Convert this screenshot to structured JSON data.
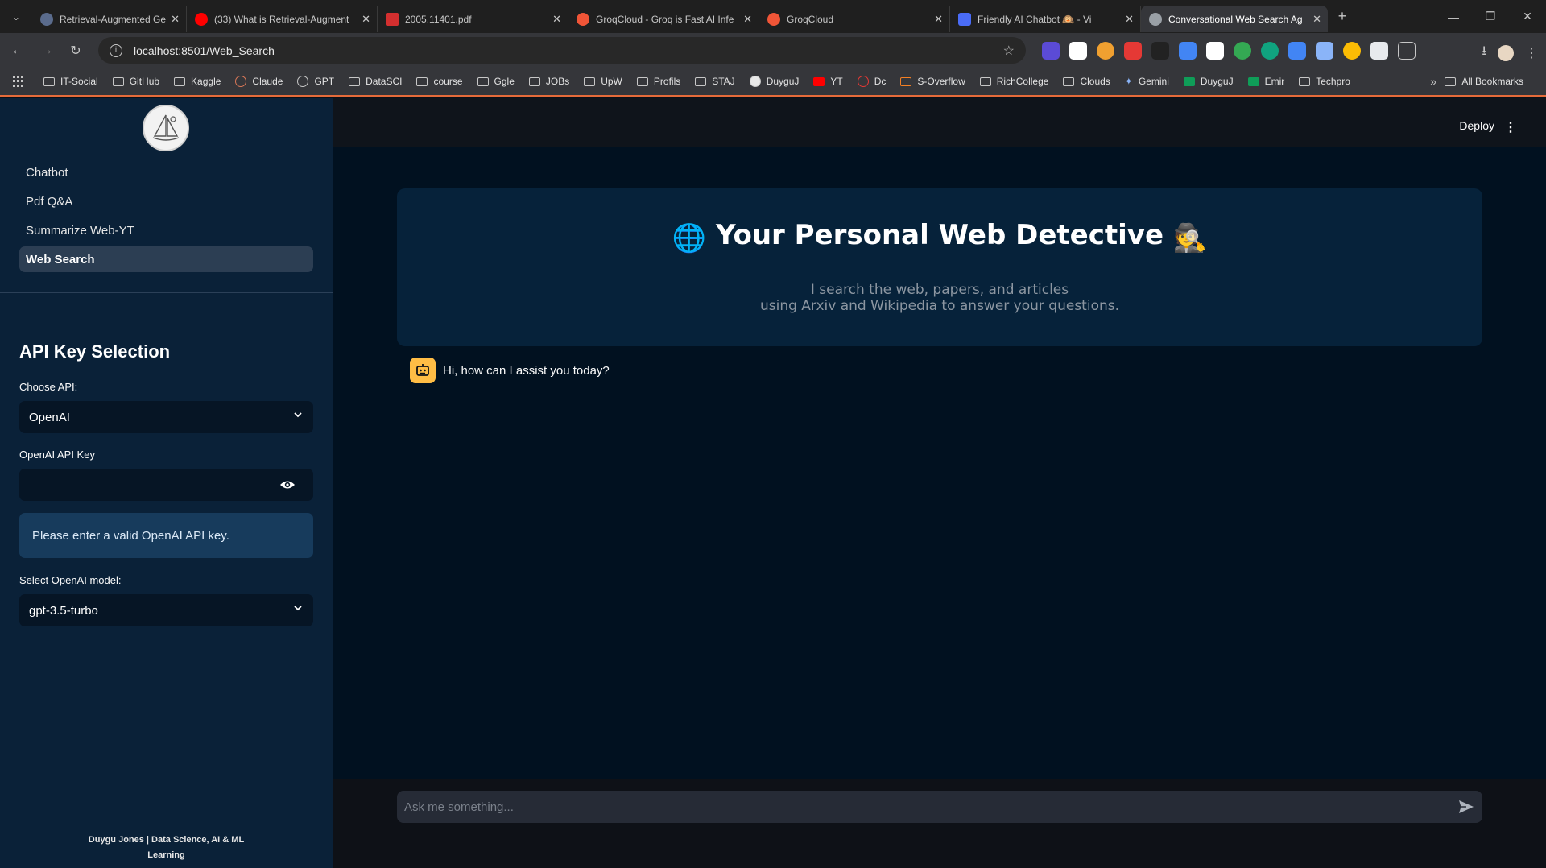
{
  "browser": {
    "tabs": [
      {
        "title": "Retrieval-Augmented Generatio",
        "favicon_color": "#5a6b8c"
      },
      {
        "title": "(33) What is Retrieval-Augment",
        "favicon_color": "#ff0000"
      },
      {
        "title": "2005.11401.pdf",
        "favicon_color": "#d32f2f"
      },
      {
        "title": "GroqCloud - Groq is Fast AI Infe",
        "favicon_color": "#f05537"
      },
      {
        "title": "GroqCloud",
        "favicon_color": "#f05537"
      },
      {
        "title": "Friendly AI Chatbot 🙉 - Vi",
        "favicon_color": "#4a6cf7"
      },
      {
        "title": "Conversational Web Search Ag",
        "favicon_color": "#9aa0a6",
        "active": true
      }
    ],
    "url": "localhost:8501/Web_Search",
    "bookmarks": [
      {
        "label": "IT-Social",
        "type": "folder"
      },
      {
        "label": "GitHub",
        "type": "folder"
      },
      {
        "label": "Kaggle",
        "type": "folder"
      },
      {
        "label": "Claude",
        "type": "site"
      },
      {
        "label": "GPT",
        "type": "site"
      },
      {
        "label": "DataSCI",
        "type": "folder"
      },
      {
        "label": "course",
        "type": "folder"
      },
      {
        "label": "Ggle",
        "type": "folder"
      },
      {
        "label": "JOBs",
        "type": "folder"
      },
      {
        "label": "UpW",
        "type": "folder"
      },
      {
        "label": "Profils",
        "type": "folder"
      },
      {
        "label": "STAJ",
        "type": "folder"
      },
      {
        "label": "DuyguJ",
        "type": "site"
      },
      {
        "label": "YT",
        "type": "site"
      },
      {
        "label": "Dc",
        "type": "site"
      },
      {
        "label": "S-Overflow",
        "type": "site"
      },
      {
        "label": "RichCollege",
        "type": "folder"
      },
      {
        "label": "Clouds",
        "type": "folder"
      },
      {
        "label": "Gemini",
        "type": "site"
      },
      {
        "label": "DuyguJ",
        "type": "site"
      },
      {
        "label": "Emir",
        "type": "site"
      },
      {
        "label": "Techpro",
        "type": "folder"
      }
    ],
    "more_label": "»",
    "all_bookmarks": "All Bookmarks"
  },
  "sidebar": {
    "nav": [
      {
        "label": "Chatbot"
      },
      {
        "label": "Pdf Q&A"
      },
      {
        "label": "Summarize Web-YT"
      },
      {
        "label": "Web Search",
        "active": true
      }
    ],
    "section_title": "API Key Selection",
    "choose_api_label": "Choose API:",
    "choose_api_value": "OpenAI",
    "api_key_label": "OpenAI API Key",
    "api_key_value": "",
    "alert": "Please enter a valid OpenAI API key.",
    "model_label": "Select OpenAI model:",
    "model_value": "gpt-3.5-turbo",
    "footer_line1": "Duygu Jones | Data Science, AI & ML",
    "footer_line2": "Learning"
  },
  "header": {
    "deploy": "Deploy",
    "menu_glyph": "⋮"
  },
  "hero": {
    "title": "Your Personal Web Detective",
    "title_emoji_left": "🌐",
    "title_emoji_right": "🕵️",
    "subtitle_line1": "I search the web, papers, and articles",
    "subtitle_line2": "using Arxiv and Wikipedia to answer your questions."
  },
  "chat": {
    "messages": [
      {
        "role": "assistant",
        "text": "Hi, how can I assist you today?"
      }
    ],
    "input_placeholder": "Ask me something..."
  },
  "colors": {
    "sidebar_bg": "#0a2138",
    "main_bg": "#011120",
    "hero_bg": "#06223a",
    "alert_bg": "#173b5c",
    "bot_avatar": "#ffbd45"
  }
}
